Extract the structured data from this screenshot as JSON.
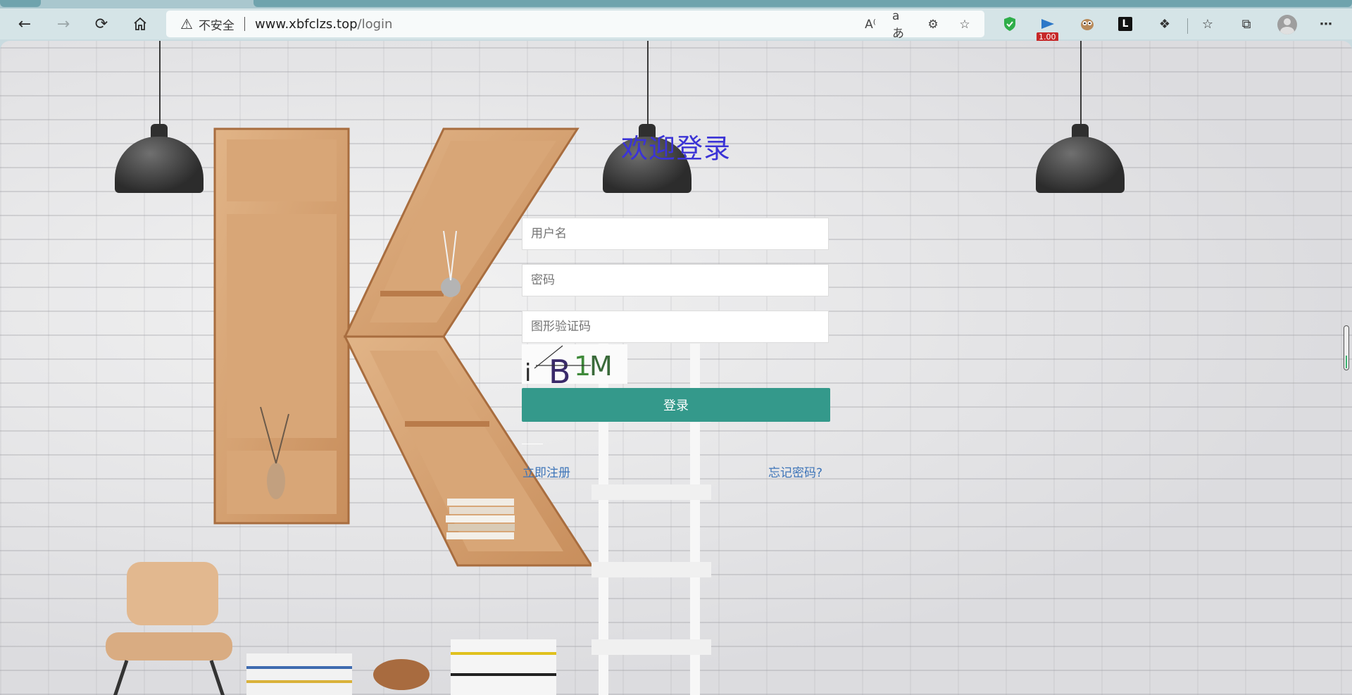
{
  "browser": {
    "address": {
      "security_label": "不安全",
      "url_host": "www.xbfclzs.top",
      "url_path": "/login"
    },
    "extension_badge": "1.00",
    "icons": {
      "back": "back-arrow-icon",
      "forward": "forward-arrow-icon",
      "reload": "reload-icon",
      "home": "home-icon",
      "warning": "warning-triangle-icon",
      "read_aloud": "read-aloud-icon",
      "translate": "translate-icon",
      "tracking": "tracking-prevention-icon",
      "favorite": "add-favorite-icon",
      "more": "more-options-icon"
    }
  },
  "login": {
    "title": "欢迎登录",
    "username_placeholder": "用户名",
    "password_placeholder": "密码",
    "captcha_placeholder": "图形验证码",
    "captcha_text": "iB1M",
    "login_button": "登录",
    "register_link": "立即注册",
    "forgot_link": "忘记密码?"
  },
  "colors": {
    "accent": "#34998b",
    "title": "#3b33d6",
    "link": "#3d74b8"
  }
}
